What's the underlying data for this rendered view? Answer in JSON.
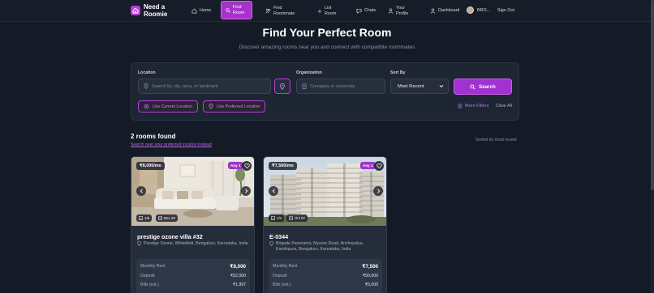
{
  "brand": {
    "name": "Need a Roomie"
  },
  "nav": {
    "home": "Home",
    "find_room": "Find Room",
    "find_roommate": "Find Roommate",
    "list_room": "List Room",
    "chats": "Chats",
    "your_profile": "Your Profile",
    "dashboard": "Dashboard",
    "user": "BRO...",
    "sign_out": "Sign Out"
  },
  "hero": {
    "title": "Find Your Perfect Room",
    "subtitle": "Discover amazing rooms near you and connect with compatible roommates"
  },
  "search": {
    "location_label": "Location",
    "location_placeholder": "Search by city, area, or landmark",
    "organization_label": "Organization",
    "organization_placeholder": "Company or university",
    "sort_label": "Sort By",
    "sort_value": "Most Recent",
    "search_button": "Search",
    "use_current_location": "Use Current Location",
    "use_preferred_location": "Use Preferred Location",
    "more_filters": "More Filters",
    "clear_all": "Clear All"
  },
  "results": {
    "count_text": "2 rooms found",
    "near_link": "Search near your preferred location instead",
    "sorted_text": "Sorted by most recent"
  },
  "listings": [
    {
      "price_tag": "₹8,000/mo",
      "gender_tag": "Any",
      "tag_count": "1",
      "photo_count": "1/5",
      "date": "Dec 20",
      "title": "prestige ozone villa #32",
      "address": "Prestige Ozone, Whitefield, Bengaluru, Karnataka, India",
      "monthly_rent_label": "Monthly Rent",
      "monthly_rent": "₹8,000",
      "deposit_label": "Deposit",
      "deposit": "₹52,000",
      "bills_label": "Bills (est.)",
      "bills": "₹1,997"
    },
    {
      "price_tag": "₹7,500/mo",
      "gender_tag": "Any",
      "tag_count": "1",
      "photo_count": "1/2",
      "date": "Oct 02",
      "title": "E-0344",
      "address": "Brigade Panorama, Mysore Road, Anchepalya, Kambipura, Bengaluru, Karnataka, India",
      "monthly_rent_label": "Monthly Rent",
      "monthly_rent": "₹7,500",
      "deposit_label": "Deposit",
      "deposit": "₹50,000",
      "bills_label": "Bills (est.)",
      "bills": "₹5,000"
    }
  ],
  "colors": {
    "background": "#141a26",
    "accent": "#a632c9",
    "panel": "#1e2533",
    "card": "#252d3b"
  },
  "icons": [
    "home-icon",
    "search-icon",
    "users-icon",
    "plus-icon",
    "chat-icon",
    "user-icon",
    "dashboard-icon",
    "map-pin-icon",
    "building-icon",
    "chevron-down-icon",
    "filter-icon",
    "heart-icon",
    "chevron-left-icon",
    "chevron-right-icon",
    "image-icon",
    "calendar-icon"
  ]
}
